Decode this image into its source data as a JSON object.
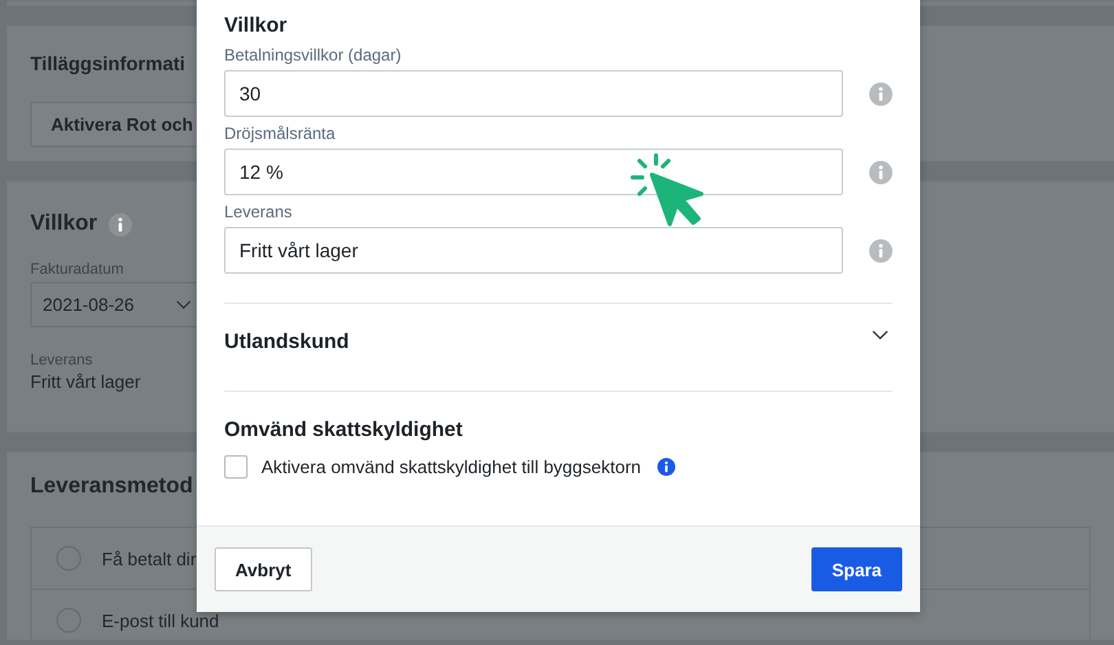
{
  "background_page": {
    "sections": [
      {
        "kind": "button_section",
        "title": "Tilläggsinformati",
        "button": "Aktivera Rot och"
      },
      {
        "kind": "terms",
        "title": "Villkor",
        "date_label": "Fakturadatum",
        "date_value": "2021-08-26",
        "delivery_label": "Leverans",
        "delivery_value": "Fritt vårt lager"
      },
      {
        "kind": "options",
        "title": "Leveransmetod",
        "options": [
          {
            "label": "Få betalt dir",
            "selected": false
          },
          {
            "label": "E-post till kund",
            "selected": false
          }
        ]
      }
    ]
  },
  "dialog": {
    "title": "Villkor",
    "fields": [
      {
        "label": "Betalningsvillkor (dagar)",
        "value": "30"
      },
      {
        "label": "Dröjsmålsränta",
        "value": "12 %"
      },
      {
        "label": "Leverans",
        "value": "Fritt vårt lager"
      }
    ],
    "collapsible": {
      "title": "Utlandskund",
      "expanded": false
    },
    "section": {
      "title": "Omvänd skattskyldighet",
      "checkbox": {
        "label": "Aktivera omvänd skattskyldighet till byggsektorn",
        "checked": false
      }
    },
    "buttons": {
      "cancel": "Avbryt",
      "save": "Spara"
    }
  }
}
